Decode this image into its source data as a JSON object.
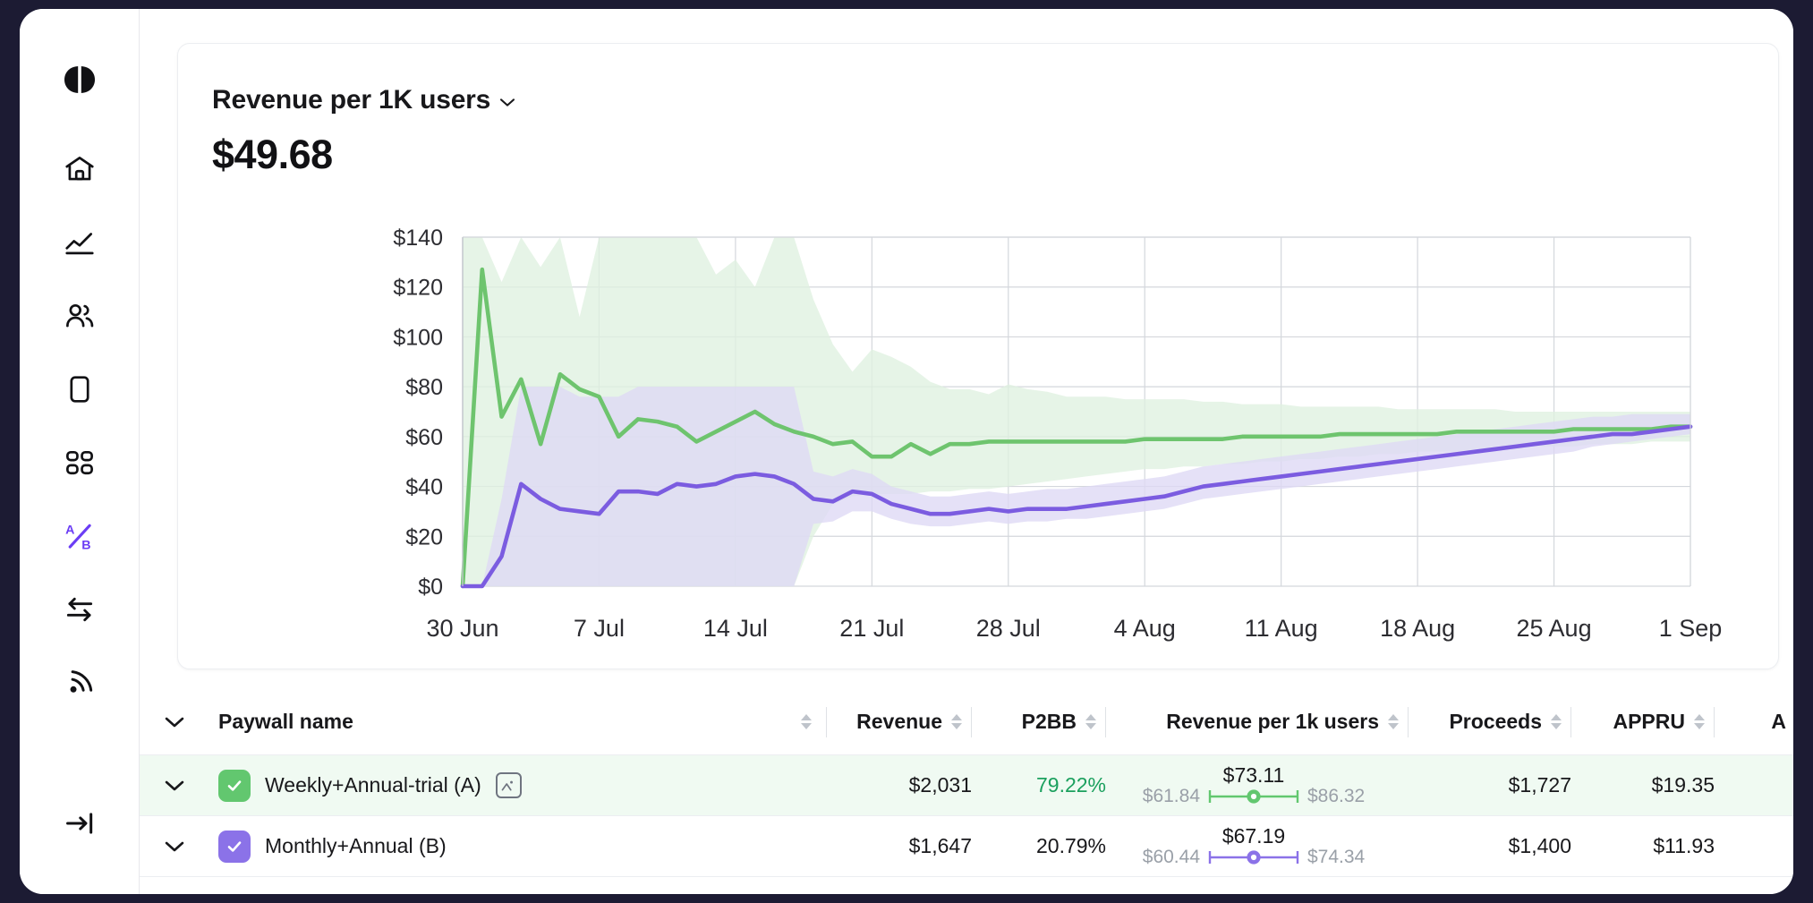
{
  "sidebar": {
    "items": [
      {
        "name": "logo",
        "label": "Logo"
      },
      {
        "name": "home",
        "label": "Home"
      },
      {
        "name": "analytics",
        "label": "Analytics"
      },
      {
        "name": "audience",
        "label": "Audience"
      },
      {
        "name": "paywalls",
        "label": "Paywalls"
      },
      {
        "name": "apps",
        "label": "Apps"
      },
      {
        "name": "ab-tests",
        "label": "A/B Tests"
      },
      {
        "name": "integrations",
        "label": "Integrations"
      },
      {
        "name": "events",
        "label": "Events"
      },
      {
        "name": "collapse",
        "label": "Collapse"
      }
    ],
    "active": "ab-tests",
    "accent": "#6b3df5"
  },
  "chart_card": {
    "metric_label": "Revenue per 1K users",
    "metric_value": "$49.68",
    "dropdown_icon": "chevron-down-icon"
  },
  "chart_data": {
    "type": "line",
    "title": "Revenue per 1K users",
    "xlabel": "",
    "ylabel": "",
    "grid": true,
    "legend": "none",
    "ylim": [
      0,
      140
    ],
    "yticks": [
      0,
      20,
      40,
      60,
      80,
      100,
      120,
      140
    ],
    "ytick_labels": [
      "$0",
      "$20",
      "$40",
      "$60",
      "$80",
      "$100",
      "$120",
      "$140"
    ],
    "xtick_labels": [
      "30 Jun",
      "7 Jul",
      "14 Jul",
      "21 Jul",
      "28 Jul",
      "4 Aug",
      "11 Aug",
      "18 Aug",
      "25 Aug",
      "1 Sep"
    ],
    "xtick_indices": [
      0,
      7,
      14,
      21,
      28,
      35,
      42,
      49,
      56,
      63
    ],
    "x_count": 64,
    "series": [
      {
        "name": "Weekly+Annual-trial (A)",
        "color": "#6ec46e",
        "band_color": "#dff1e0",
        "values": [
          0,
          127,
          68,
          83,
          57,
          85,
          79,
          76,
          60,
          67,
          66,
          64,
          58,
          62,
          66,
          70,
          65,
          62,
          60,
          57,
          58,
          52,
          52,
          57,
          53,
          57,
          57,
          58,
          58,
          58,
          58,
          58,
          58,
          58,
          58,
          59,
          59,
          59,
          59,
          59,
          60,
          60,
          60,
          60,
          60,
          61,
          61,
          61,
          61,
          61,
          61,
          62,
          62,
          62,
          62,
          62,
          62,
          63,
          63,
          63,
          63,
          63,
          64,
          64
        ],
        "band_lower": [
          0,
          0,
          0,
          0,
          0,
          0,
          0,
          0,
          0,
          0,
          0,
          0,
          0,
          0,
          0,
          0,
          0,
          0,
          20,
          33,
          36,
          37,
          37,
          37,
          38,
          38,
          39,
          39,
          40,
          41,
          42,
          43,
          44,
          45,
          46,
          47,
          47,
          48,
          48,
          49,
          49,
          50,
          50,
          51,
          51,
          52,
          52,
          53,
          53,
          54,
          54,
          54,
          55,
          55,
          55,
          56,
          56,
          56,
          57,
          57,
          57,
          58,
          58,
          58
        ],
        "band_upper": [
          140,
          140,
          122,
          140,
          128,
          140,
          108,
          140,
          140,
          140,
          140,
          140,
          140,
          125,
          131,
          120,
          140,
          140,
          115,
          97,
          86,
          95,
          92,
          88,
          82,
          79,
          79,
          77,
          81,
          79,
          78,
          76,
          76,
          76,
          75,
          75,
          75,
          75,
          74,
          74,
          73,
          73,
          73,
          72,
          72,
          72,
          72,
          72,
          71,
          71,
          71,
          71,
          71,
          71,
          70,
          70,
          70,
          70,
          70,
          70,
          70,
          70,
          70,
          70
        ]
      },
      {
        "name": "Monthly+Annual (B)",
        "color": "#7b5ce0",
        "band_color": "#ded8f5",
        "values": [
          0,
          0,
          12,
          41,
          35,
          31,
          30,
          29,
          38,
          38,
          37,
          41,
          40,
          41,
          44,
          45,
          44,
          41,
          35,
          34,
          38,
          37,
          33,
          31,
          29,
          29,
          30,
          31,
          30,
          31,
          31,
          31,
          32,
          33,
          34,
          35,
          36,
          38,
          40,
          41,
          42,
          43,
          44,
          45,
          46,
          47,
          48,
          49,
          50,
          51,
          52,
          53,
          54,
          55,
          56,
          57,
          58,
          59,
          60,
          61,
          61,
          62,
          63,
          64
        ],
        "band_lower": [
          0,
          0,
          0,
          0,
          0,
          0,
          0,
          0,
          0,
          0,
          0,
          0,
          0,
          0,
          0,
          0,
          0,
          0,
          25,
          26,
          30,
          30,
          27,
          25,
          24,
          24,
          25,
          26,
          25,
          26,
          26,
          27,
          27,
          28,
          29,
          30,
          31,
          33,
          35,
          36,
          37,
          38,
          39,
          40,
          41,
          42,
          43,
          44,
          45,
          46,
          47,
          48,
          49,
          50,
          51,
          52,
          53,
          54,
          56,
          57,
          58,
          59,
          60,
          61
        ],
        "band_upper": [
          0,
          0,
          35,
          80,
          80,
          80,
          76,
          76,
          76,
          80,
          80,
          80,
          80,
          80,
          80,
          80,
          80,
          80,
          46,
          44,
          47,
          45,
          40,
          38,
          36,
          36,
          37,
          38,
          37,
          38,
          39,
          39,
          40,
          41,
          42,
          43,
          44,
          46,
          48,
          49,
          50,
          51,
          52,
          53,
          54,
          55,
          56,
          57,
          58,
          59,
          60,
          61,
          62,
          63,
          64,
          65,
          66,
          67,
          68,
          68,
          69,
          69,
          69,
          69
        ]
      }
    ]
  },
  "table": {
    "columns": [
      {
        "key": "expand",
        "label": ""
      },
      {
        "key": "name",
        "label": "Paywall name",
        "sortable": true
      },
      {
        "key": "revenue",
        "label": "Revenue",
        "sortable": true
      },
      {
        "key": "p2bb",
        "label": "P2BB",
        "sortable": true
      },
      {
        "key": "rpk",
        "label": "Revenue per 1k users",
        "sortable": true
      },
      {
        "key": "proceeds",
        "label": "Proceeds",
        "sortable": true
      },
      {
        "key": "appru",
        "label": "APPRU",
        "sortable": true
      },
      {
        "key": "cut",
        "label": "A"
      }
    ],
    "rows": [
      {
        "name": "Weekly+Annual-trial (A)",
        "checked": true,
        "color": "#62c76f",
        "has_image_badge": true,
        "revenue": "$2,031",
        "p2bb": "79.22%",
        "p2bb_positive": true,
        "rpk_mid": "$73.11",
        "rpk_low": "$61.84",
        "rpk_high": "$86.32",
        "proceeds": "$1,727",
        "appru": "$19.35",
        "selected": true
      },
      {
        "name": "Monthly+Annual (B)",
        "checked": true,
        "color": "#8b72e8",
        "has_image_badge": false,
        "revenue": "$1,647",
        "p2bb": "20.79%",
        "p2bb_positive": false,
        "rpk_mid": "$67.19",
        "rpk_low": "$60.44",
        "rpk_high": "$74.34",
        "proceeds": "$1,400",
        "appru": "$11.93",
        "selected": false
      }
    ]
  }
}
